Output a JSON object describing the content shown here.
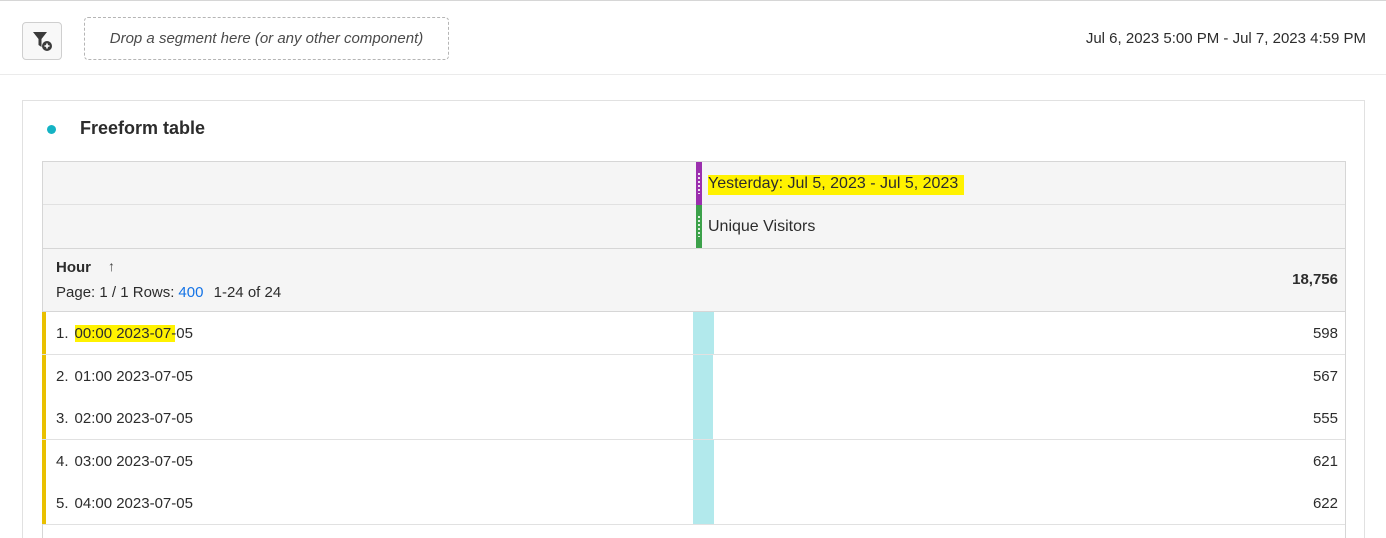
{
  "toolbar": {
    "filter_icon": "filter-add-icon",
    "dropzone_text": "Drop a segment here (or any other component)",
    "date_range": "Jul 6, 2023 5:00 PM - Jul 7, 2023 4:59 PM"
  },
  "panel": {
    "title": "Freeform table",
    "accent_color": "#14b3c4"
  },
  "table": {
    "column_date_label": "Yesterday: Jul 5, 2023 - Jul 5, 2023",
    "column_metric_label": "Unique Visitors",
    "dimension_label": "Hour",
    "sort_icon": "arrow-up-icon",
    "pager": {
      "page_text": "Page: 1 / 1",
      "rows_label": "Rows:",
      "rows_value": "400",
      "range_text": "1-24 of 24"
    },
    "total": "18,756",
    "rows": [
      {
        "num": "1.",
        "label": "00:00 2023-07-05",
        "value": "598",
        "bar_fraction": 0.032
      },
      {
        "num": "2.",
        "label": "01:00 2023-07-05",
        "value": "567",
        "bar_fraction": 0.03
      },
      {
        "num": "3.",
        "label": "02:00 2023-07-05",
        "value": "555",
        "bar_fraction": 0.03
      },
      {
        "num": "4.",
        "label": "03:00 2023-07-05",
        "value": "621",
        "bar_fraction": 0.033
      },
      {
        "num": "5.",
        "label": "04:00 2023-07-05",
        "value": "622",
        "bar_fraction": 0.033
      }
    ]
  }
}
